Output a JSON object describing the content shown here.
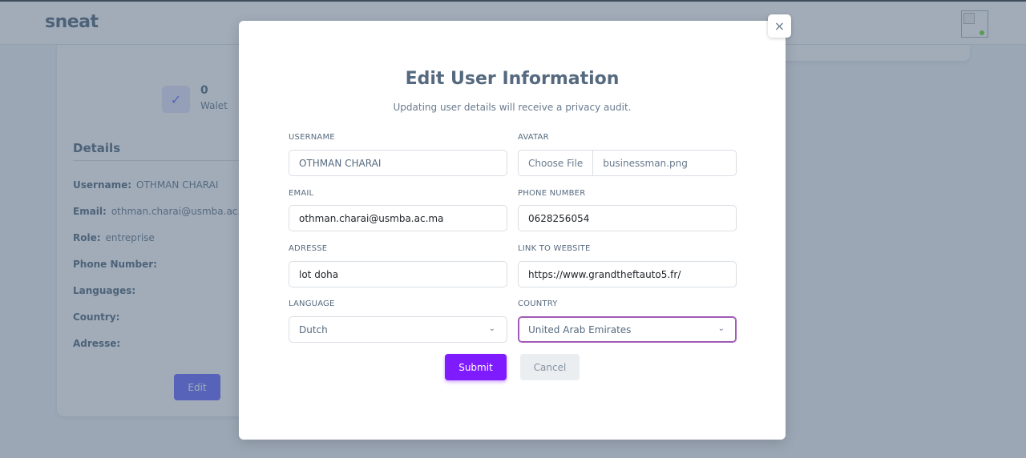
{
  "app": {
    "brand": "sneat"
  },
  "profile": {
    "wallet_value": "0",
    "wallet_label": "Walet",
    "details_title": "Details",
    "details": [
      {
        "key": "Username:",
        "value": "OTHMAN CHARAI"
      },
      {
        "key": "Email:",
        "value": "othman.charai@usmba.ac.m"
      },
      {
        "key": "Role:",
        "value": "entreprise"
      },
      {
        "key": "Phone Number:",
        "value": ""
      },
      {
        "key": "Languages:",
        "value": ""
      },
      {
        "key": "Country:",
        "value": ""
      },
      {
        "key": "Adresse:",
        "value": ""
      }
    ],
    "edit_label": "Edit"
  },
  "modal": {
    "close_icon": "×",
    "title": "Edit User Information",
    "subtitle": "Updating user details will receive a privacy audit.",
    "fields": {
      "username": {
        "label": "USERNAME",
        "placeholder": "OTHMAN CHARAI"
      },
      "avatar": {
        "label": "AVATAR",
        "button": "Choose File",
        "filename": "businessman.png"
      },
      "email": {
        "label": "EMAIL",
        "value": "othman.charai@usmba.ac.ma"
      },
      "phone": {
        "label": "PHONE NUMBER",
        "value": "0628256054"
      },
      "adresse": {
        "label": "ADRESSE",
        "value": "lot doha"
      },
      "website": {
        "label": "LINK TO WEBSITE",
        "value": "https://www.grandtheftauto5.fr/"
      },
      "language": {
        "label": "LANGUAGE",
        "selected": "Dutch"
      },
      "country": {
        "label": "COUNTRY",
        "selected": "United Arab Emirates"
      }
    },
    "submit_label": "Submit",
    "cancel_label": "Cancel"
  },
  "colors": {
    "primary": "#696cff",
    "submit": "#7f1bff",
    "focus": "#a15ab5"
  }
}
